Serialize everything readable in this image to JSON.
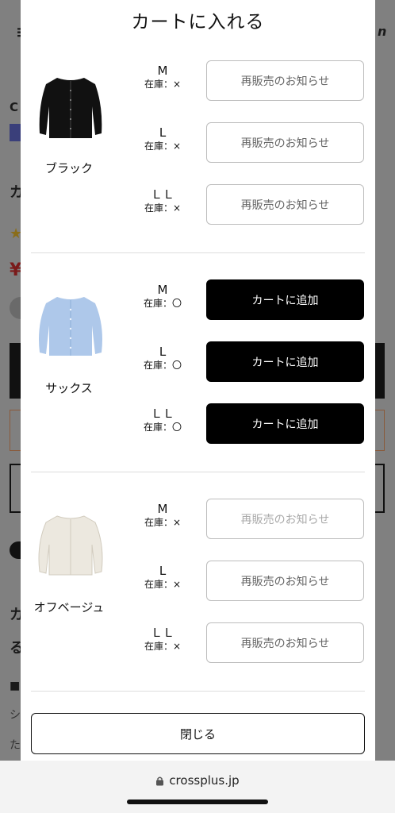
{
  "modal": {
    "title": "カートに入れる",
    "close_label": "閉じる"
  },
  "colors": {
    "accent": "#000000",
    "notify_border": "#bdbdbd",
    "overlay": "#808080"
  },
  "groups": [
    {
      "color_name": "ブラック",
      "image": "black-cardigan",
      "sizes": [
        {
          "size": "M",
          "stock": "在庫：×",
          "button": "再販売のお知らせ",
          "type": "notify"
        },
        {
          "size": "L",
          "stock": "在庫：×",
          "button": "再販売のお知らせ",
          "type": "notify"
        },
        {
          "size": "ＬＬ",
          "stock": "在庫：×",
          "button": "再販売のお知らせ",
          "type": "notify"
        }
      ]
    },
    {
      "color_name": "サックス",
      "image": "sax-cardigan",
      "sizes": [
        {
          "size": "M",
          "stock": "在庫：〇",
          "button": "カートに追加",
          "type": "add"
        },
        {
          "size": "L",
          "stock": "在庫：〇",
          "button": "カートに追加",
          "type": "add"
        },
        {
          "size": "ＬＬ",
          "stock": "在庫：〇",
          "button": "カートに追加",
          "type": "add"
        }
      ]
    },
    {
      "color_name": "オフベージュ",
      "image": "offbeige-cardigan",
      "sizes": [
        {
          "size": "M",
          "stock": "在庫：×",
          "button": "再販売のお知らせ",
          "type": "notify"
        },
        {
          "size": "L",
          "stock": "在庫：×",
          "button": "再販売のお知らせ",
          "type": "notify"
        },
        {
          "size": "ＬＬ",
          "stock": "在庫：×",
          "button": "再販売のお知らせ",
          "type": "notify"
        }
      ]
    }
  ],
  "browser": {
    "url": "crossplus.jp",
    "lock_icon": "lock-icon"
  }
}
